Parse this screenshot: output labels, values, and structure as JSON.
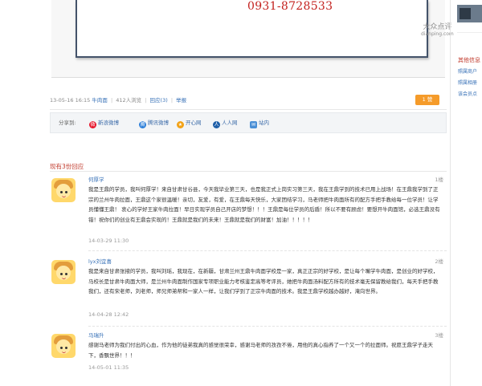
{
  "image_area": {
    "phone": "0931-8728533",
    "watermark": {
      "brand": "大众点评",
      "url": "dianping.com"
    }
  },
  "meta": {
    "timestamp": "13-05-16 16:15",
    "shop": "牛肉面",
    "views": "412人浏览",
    "replies": "回应(3)",
    "report": "举报",
    "like_button": "赞",
    "like_count": "1"
  },
  "share": {
    "label": "分享到:",
    "items": [
      "新浪微博",
      "腾讯微博",
      "开心网",
      "人人网",
      "站内"
    ]
  },
  "replies_title": "现有3份回应",
  "comments": [
    {
      "user": "何厚学",
      "floor": "1楼",
      "text": "我是王鼎的学员，我叫何厚学！来自甘肃甘谷县，今天我毕业第三天，也是我正式上岗实习第三天，我在王鼎学到的技术已用上战场！在王鼎我学到了正宗的兰州牛肉拉面，王鼎这个家很温暖！亲切，友爱，有爱，在王鼎每天快乐，大家团结学习，马老师把牛肉面所有的配方手把手教给每一位学员！让学员懂懂王鼎！ 衷心的学好王家牛肉拉面！早日实现学员自己开店的梦想！！！王鼎是每位学员的后盾！所以不要有顾虑！要想开牛肉面馆，必选王鼎没有错！祝你们的创业有王鼎会实现的！王鼎就是我们的未来！王鼎就是我们的财富！加油！！！！！",
      "time": "14-03-29 11:30"
    },
    {
      "user": "lyx刘宜喜",
      "floor": "2楼",
      "text": "我是来自甘肃张掖的学员，我叫刘瑶，我现在，在新疆，甘肃兰州王鼎牛肉面学校是一家，真正正宗的好学校，是让每个嘴学牛肉面，是创业的好学校，马校长是甘肃牛肉面大师，是兰州牛肉面制作国家专项职业能力考核鉴定高等考评员，她把牛肉面汤料配方所有的技术毫无保留教给我们，每天手把手教我们，还有宋老师，刘老师，师兄师弟帮和一家人一样，让我们学到了正宗牛肉面的技术。我是王鼎学校越办越好，淹向世界。",
      "time": "14-04-28 12:42"
    },
    {
      "user": "马瑞升",
      "floor": "3楼",
      "text": "感谢马老师为我们付出的心血，作为他的徒弟我真的感觉很荣幸，感谢马老师的孜孜不倦，用他的真心指养了一个又一个的拉面师。祝愿王鼎学子走天下，香飘世界！！！",
      "time": "14-05-01 11:35"
    }
  ],
  "sidebar": {
    "title": "其他信息",
    "links": [
      "照属商户",
      "照属相册",
      "该会员点"
    ]
  },
  "colors": {
    "accent": "#c0392b",
    "link": "#3a73b8",
    "button": "#f59b2a"
  }
}
